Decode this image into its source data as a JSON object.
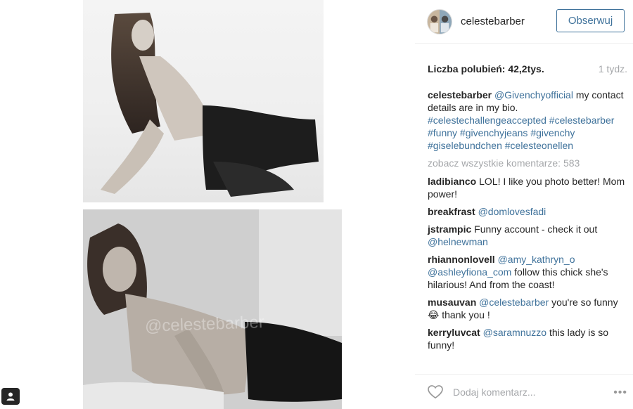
{
  "post": {
    "watermark": "@celestebarber"
  },
  "header": {
    "username": "celestebarber",
    "follow_label": "Obserwuj"
  },
  "stats": {
    "likes_label": "Liczba polubień:",
    "likes_count": "42,2tys.",
    "age": "1 tydz."
  },
  "caption": {
    "user": "celestebarber",
    "mention": "@Givenchyofficial",
    "text": " my contact details are in my bio.",
    "hashtags": "#celestechallengeaccepted #celestebarber #funny #givenchyjeans #givenchy #giselebundchen #celesteonellen"
  },
  "view_all_comments": "zobacz wszystkie komentarze: 583",
  "comments": [
    {
      "user": "ladibianco",
      "parts": [
        {
          "t": "text",
          "v": "LOL! I like you photo better! Mom power!"
        }
      ]
    },
    {
      "user": "breakfrast",
      "parts": [
        {
          "t": "link",
          "v": "@domlovesfadi"
        }
      ]
    },
    {
      "user": "jstrampic",
      "parts": [
        {
          "t": "text",
          "v": "Funny account - check it out "
        },
        {
          "t": "link",
          "v": "@helnewman"
        }
      ]
    },
    {
      "user": "rhiannonlovell",
      "parts": [
        {
          "t": "link",
          "v": "@amy_kathryn_o"
        },
        {
          "t": "text",
          "v": " "
        },
        {
          "t": "link",
          "v": "@ashleyfiona_com"
        },
        {
          "t": "text",
          "v": " follow this chick she's hilarious! And from the coast!"
        }
      ]
    },
    {
      "user": "musauvan",
      "parts": [
        {
          "t": "link",
          "v": "@celestebarber"
        },
        {
          "t": "text",
          "v": " you're so funny 😂 thank you !"
        }
      ]
    },
    {
      "user": "kerryluvcat",
      "parts": [
        {
          "t": "link",
          "v": "@saramnuzzo"
        },
        {
          "t": "text",
          "v": " this lady is so funny!"
        }
      ]
    }
  ],
  "footer": {
    "add_comment_placeholder": "Dodaj komentarz...",
    "more_label": "•••"
  },
  "colors": {
    "link": "#3f729b",
    "muted": "#a5a7aa",
    "text": "#262626",
    "border": "#efefef"
  },
  "icons": [
    "heart-icon",
    "more-options-icon",
    "user-icon"
  ]
}
